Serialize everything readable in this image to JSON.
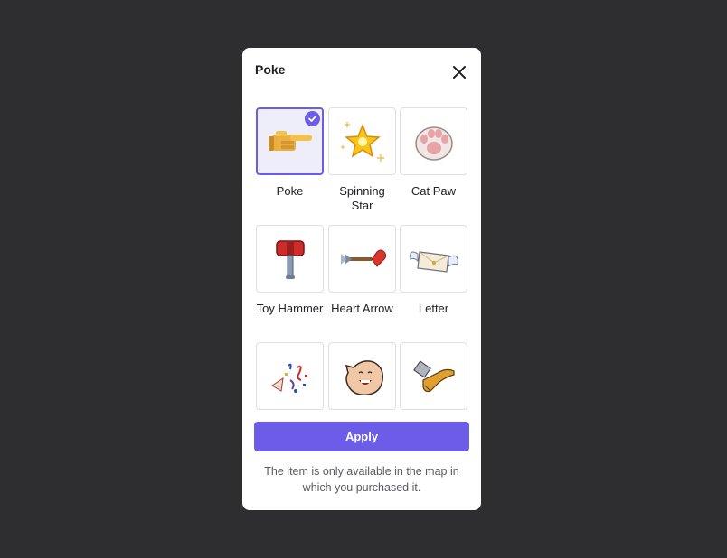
{
  "dialog": {
    "title": "Poke",
    "close_icon": "close-icon"
  },
  "items": [
    {
      "label": "Poke",
      "icon": "pointing-hand-icon",
      "selected": true
    },
    {
      "label": "Spinning Star",
      "icon": "star-icon",
      "selected": false
    },
    {
      "label": "Cat Paw",
      "icon": "cat-paw-icon",
      "selected": false
    },
    {
      "label": "Toy Hammer",
      "icon": "hammer-icon",
      "selected": false
    },
    {
      "label": "Heart Arrow",
      "icon": "heart-arrow-icon",
      "selected": false
    },
    {
      "label": "Letter",
      "icon": "winged-letter-icon",
      "selected": false
    },
    {
      "label": "",
      "icon": "confetti-icon",
      "selected": false
    },
    {
      "label": "",
      "icon": "laughing-face-icon",
      "selected": false
    },
    {
      "label": "",
      "icon": "kick-foot-icon",
      "selected": false
    }
  ],
  "apply_label": "Apply",
  "note": "The item is only available in the map in which you purchased it.",
  "colors": {
    "backdrop": "#2e2e30",
    "accent": "#6c5ce7",
    "selected_bg": "#eeeefb"
  }
}
